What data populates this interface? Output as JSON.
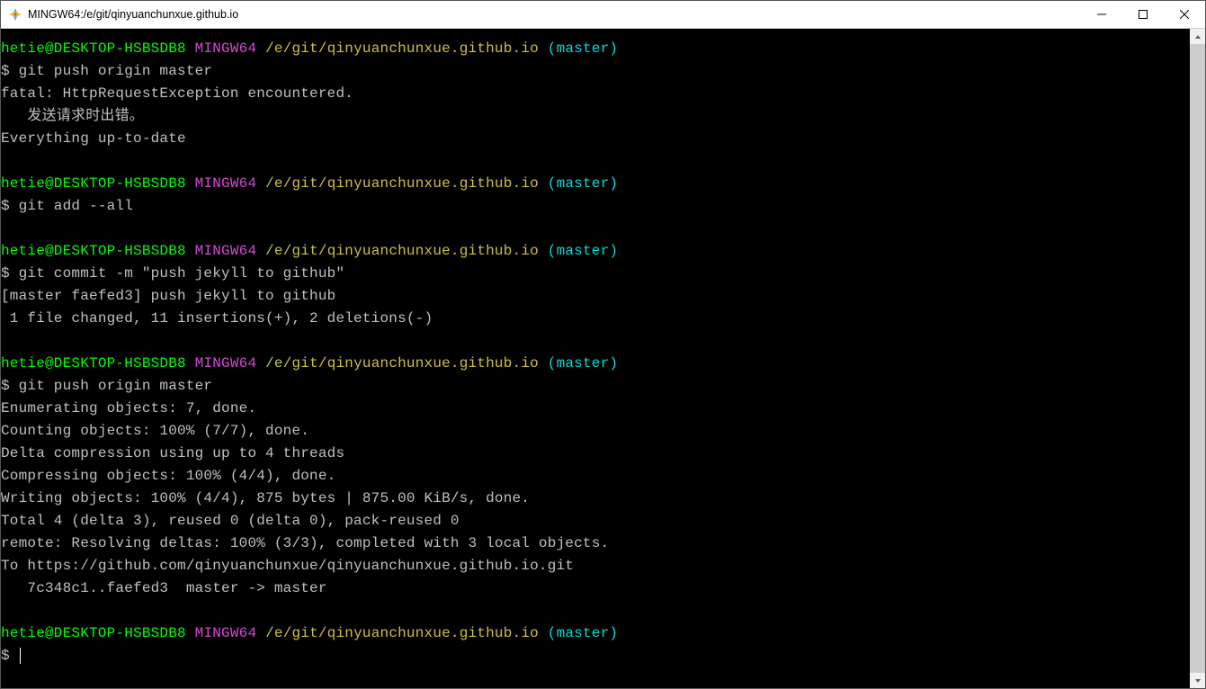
{
  "window": {
    "title": "MINGW64:/e/git/qinyuanchunxue.github.io"
  },
  "prompt": {
    "user": "hetie@DESKTOP-HSBSDB8",
    "env": "MINGW64",
    "path": "/e/git/qinyuanchunxue.github.io",
    "branch": "(master)"
  },
  "blocks": [
    {
      "cmd": "git push origin master",
      "out": "fatal: HttpRequestException encountered.\n   发送请求时出错。\nEverything up-to-date"
    },
    {
      "cmd": "git add --all",
      "out": ""
    },
    {
      "cmd": "git commit -m \"push jekyll to github\"",
      "out": "[master faefed3] push jekyll to github\n 1 file changed, 11 insertions(+), 2 deletions(-)"
    },
    {
      "cmd": "git push origin master",
      "out": "Enumerating objects: 7, done.\nCounting objects: 100% (7/7), done.\nDelta compression using up to 4 threads\nCompressing objects: 100% (4/4), done.\nWriting objects: 100% (4/4), 875 bytes | 875.00 KiB/s, done.\nTotal 4 (delta 3), reused 0 (delta 0), pack-reused 0\nremote: Resolving deltas: 100% (3/3), completed with 3 local objects.\nTo https://github.com/qinyuanchunxue/qinyuanchunxue.github.io.git\n   7c348c1..faefed3  master -> master"
    }
  ],
  "dollar": "$ "
}
